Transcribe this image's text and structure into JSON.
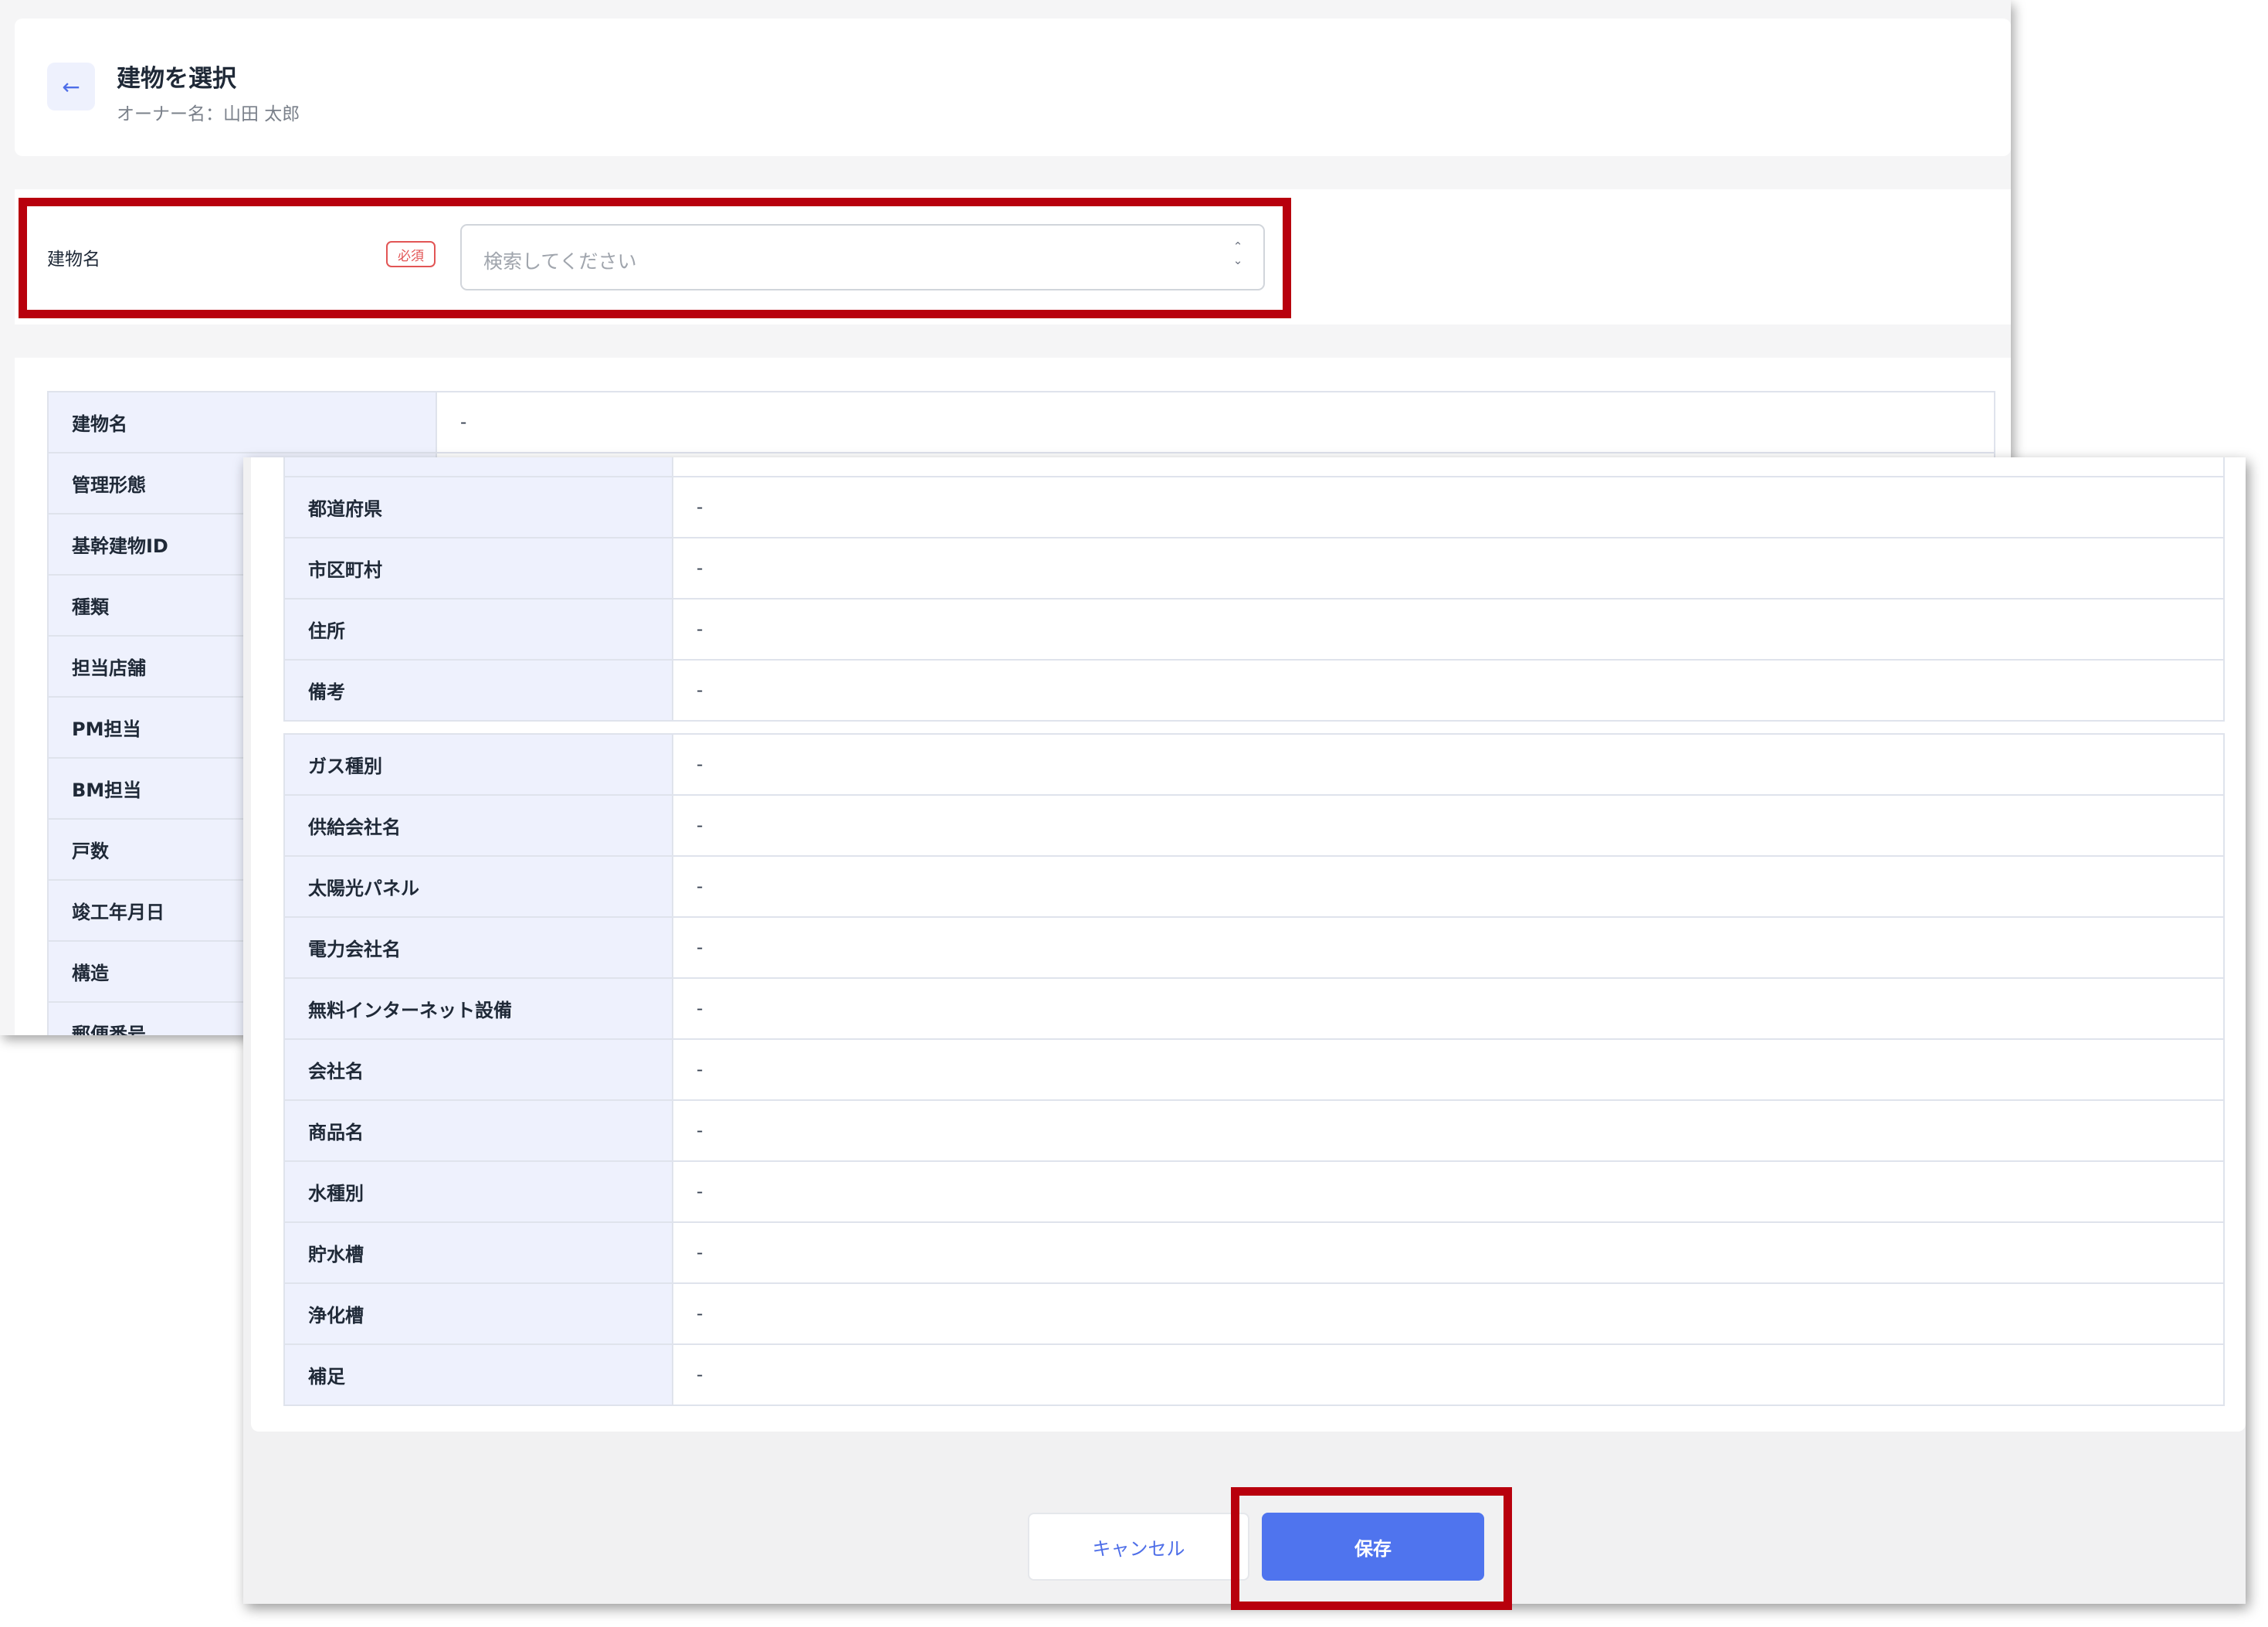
{
  "header": {
    "back_icon": "←",
    "title": "建物を選択",
    "owner_line": "オーナー名：山田 太郎"
  },
  "building_select": {
    "label": "建物名",
    "required_badge": "必須",
    "placeholder": "検索してください",
    "updown_icon_up": "⌃",
    "updown_icon_down": "⌄"
  },
  "details_back": [
    {
      "label": "建物名",
      "value": "-"
    },
    {
      "label": "管理形態",
      "value": "-"
    },
    {
      "label": "基幹建物ID",
      "value": "-"
    },
    {
      "label": "種類",
      "value": "-"
    },
    {
      "label": "担当店舗",
      "value": "-"
    },
    {
      "label": "PM担当",
      "value": "-"
    },
    {
      "label": "BM担当",
      "value": "-"
    },
    {
      "label": "戸数",
      "value": "-"
    },
    {
      "label": "竣工年月日",
      "value": "-"
    },
    {
      "label": "構造",
      "value": "-"
    },
    {
      "label": "郵便番号",
      "value": "-"
    }
  ],
  "details_front_group1": [
    {
      "label": "都道府県",
      "value": "-"
    },
    {
      "label": "市区町村",
      "value": "-"
    },
    {
      "label": "住所",
      "value": "-"
    },
    {
      "label": "備考",
      "value": "-"
    }
  ],
  "details_front_group2": [
    {
      "label": "ガス種別",
      "value": "-"
    },
    {
      "label": "供給会社名",
      "value": "-"
    },
    {
      "label": "太陽光パネル",
      "value": "-"
    },
    {
      "label": "電力会社名",
      "value": "-"
    },
    {
      "label": "無料インターネット設備",
      "value": "-"
    },
    {
      "label": "会社名",
      "value": "-"
    },
    {
      "label": "商品名",
      "value": "-"
    },
    {
      "label": "水種別",
      "value": "-"
    },
    {
      "label": "貯水槽",
      "value": "-"
    },
    {
      "label": "浄化槽",
      "value": "-"
    },
    {
      "label": "補足",
      "value": "-"
    }
  ],
  "footer": {
    "cancel_label": "キャンセル",
    "save_label": "保存"
  },
  "colors": {
    "accent": "#4f74ee",
    "highlight": "#b8000d",
    "required": "#e25555",
    "label_bg": "#eef1fd"
  }
}
